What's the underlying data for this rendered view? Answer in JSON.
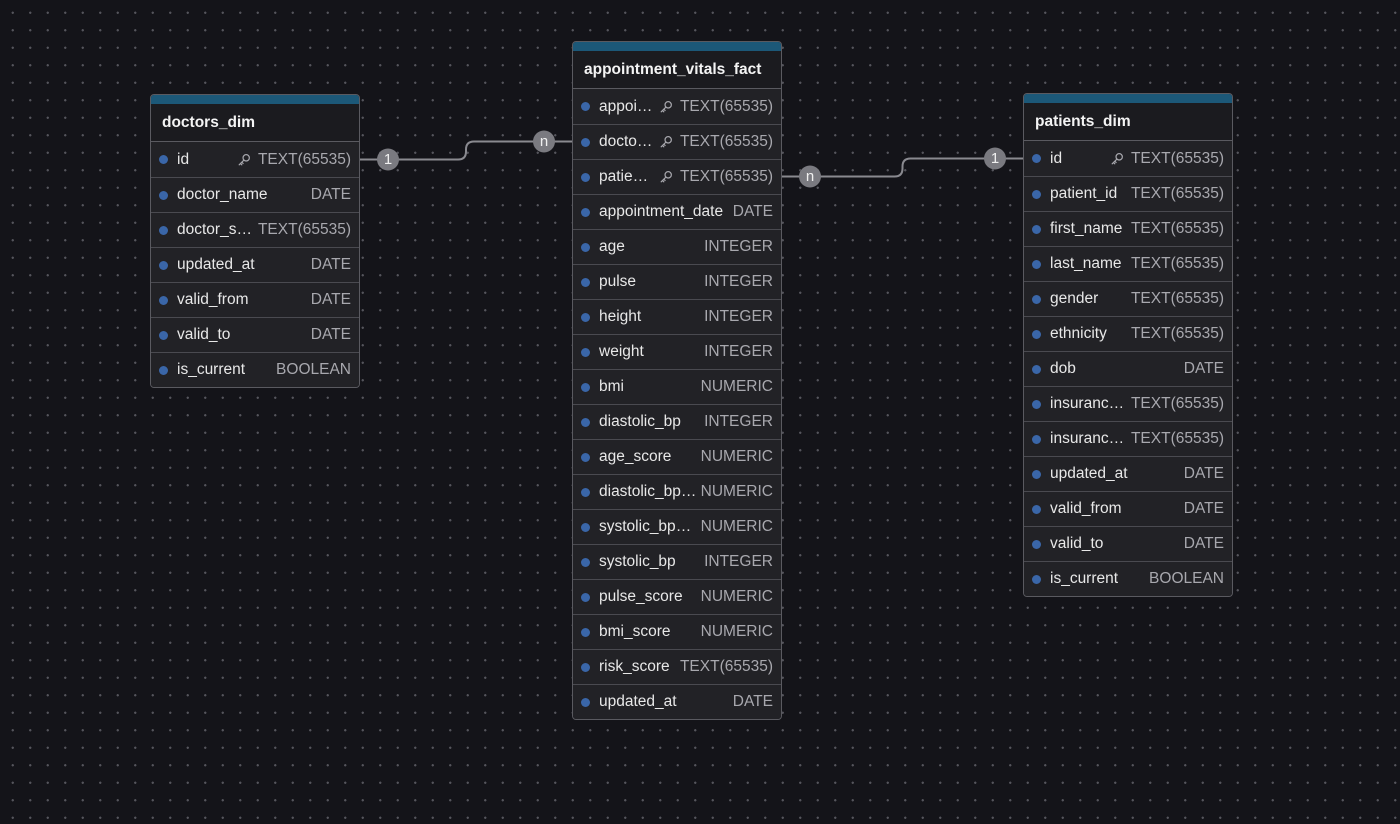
{
  "colors": {
    "background": "#141419",
    "table_bg": "#1f1f23",
    "table_border": "#5a5a60",
    "header_accent": "#1c5878",
    "column_dot": "#3a66a8",
    "edge": "#8a8a90",
    "cardinality_badge": "#7a7a80"
  },
  "tables": [
    {
      "id": "doctors",
      "name": "doctors_dim",
      "columns": [
        {
          "name": "id",
          "type": "TEXT(65535)",
          "key": true
        },
        {
          "name": "doctor_name",
          "type": "DATE",
          "key": false
        },
        {
          "name": "doctor_s…",
          "type": "TEXT(65535)",
          "key": false
        },
        {
          "name": "updated_at",
          "type": "DATE",
          "key": false
        },
        {
          "name": "valid_from",
          "type": "DATE",
          "key": false
        },
        {
          "name": "valid_to",
          "type": "DATE",
          "key": false
        },
        {
          "name": "is_current",
          "type": "BOOLEAN",
          "key": false
        }
      ]
    },
    {
      "id": "appointments",
      "name": "appointment_vitals_fact",
      "columns": [
        {
          "name": "appoi…",
          "type": "TEXT(65535)",
          "key": true
        },
        {
          "name": "docto…",
          "type": "TEXT(65535)",
          "key": true
        },
        {
          "name": "patien…",
          "type": "TEXT(65535)",
          "key": true
        },
        {
          "name": "appointment_date",
          "type": "DATE",
          "key": false
        },
        {
          "name": "age",
          "type": "INTEGER",
          "key": false
        },
        {
          "name": "pulse",
          "type": "INTEGER",
          "key": false
        },
        {
          "name": "height",
          "type": "INTEGER",
          "key": false
        },
        {
          "name": "weight",
          "type": "INTEGER",
          "key": false
        },
        {
          "name": "bmi",
          "type": "NUMERIC",
          "key": false
        },
        {
          "name": "diastolic_bp",
          "type": "INTEGER",
          "key": false
        },
        {
          "name": "age_score",
          "type": "NUMERIC",
          "key": false
        },
        {
          "name": "diastolic_bp…",
          "type": "NUMERIC",
          "key": false
        },
        {
          "name": "systolic_bp_…",
          "type": "NUMERIC",
          "key": false
        },
        {
          "name": "systolic_bp",
          "type": "INTEGER",
          "key": false
        },
        {
          "name": "pulse_score",
          "type": "NUMERIC",
          "key": false
        },
        {
          "name": "bmi_score",
          "type": "NUMERIC",
          "key": false
        },
        {
          "name": "risk_score",
          "type": "TEXT(65535)",
          "key": false
        },
        {
          "name": "updated_at",
          "type": "DATE",
          "key": false
        }
      ]
    },
    {
      "id": "patients",
      "name": "patients_dim",
      "columns": [
        {
          "name": "id",
          "type": "TEXT(65535)",
          "key": true
        },
        {
          "name": "patient_id",
          "type": "TEXT(65535)",
          "key": false
        },
        {
          "name": "first_name",
          "type": "TEXT(65535)",
          "key": false
        },
        {
          "name": "last_name",
          "type": "TEXT(65535)",
          "key": false
        },
        {
          "name": "gender",
          "type": "TEXT(65535)",
          "key": false
        },
        {
          "name": "ethnicity",
          "type": "TEXT(65535)",
          "key": false
        },
        {
          "name": "dob",
          "type": "DATE",
          "key": false
        },
        {
          "name": "insuranc…",
          "type": "TEXT(65535)",
          "key": false
        },
        {
          "name": "insuranc…",
          "type": "TEXT(65535)",
          "key": false
        },
        {
          "name": "updated_at",
          "type": "DATE",
          "key": false
        },
        {
          "name": "valid_from",
          "type": "DATE",
          "key": false
        },
        {
          "name": "valid_to",
          "type": "DATE",
          "key": false
        },
        {
          "name": "is_current",
          "type": "BOOLEAN",
          "key": false
        }
      ]
    }
  ],
  "relationships": [
    {
      "from_table": "doctors",
      "from_column": 0,
      "from_cardinality": "1",
      "to_table": "appointments",
      "to_column": 1,
      "to_cardinality": "n"
    },
    {
      "from_table": "appointments",
      "from_column": 2,
      "from_cardinality": "n",
      "to_table": "patients",
      "to_column": 0,
      "to_cardinality": "1"
    }
  ]
}
